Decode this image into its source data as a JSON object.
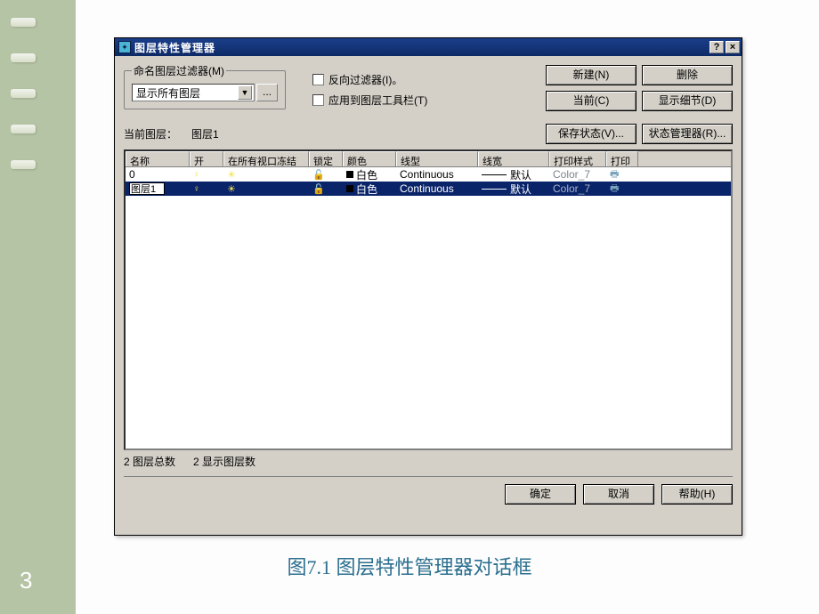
{
  "slide": {
    "page_number": "3",
    "caption": "图7.1  图层特性管理器对话框"
  },
  "dialog": {
    "title": "图层特性管理器",
    "help_btn": "?",
    "close_btn": "×",
    "filter": {
      "legend": "命名图层过滤器(M)",
      "selected": "显示所有图层",
      "more_btn": "...",
      "reverse_filter": "反向过滤器(I)。",
      "apply_toolbar": "应用到图层工具栏(T)"
    },
    "buttons": {
      "new": "新建(N)",
      "delete": "删除",
      "current": "当前(C)",
      "show_detail": "显示细节(D)",
      "save_state": "保存状态(V)...",
      "state_mgr": "状态管理器(R)...",
      "ok": "确定",
      "cancel": "取消",
      "help": "帮助(H)"
    },
    "current_layer_label": "当前图层：",
    "current_layer_value": "图层1",
    "columns": {
      "name": "名称",
      "on": "开",
      "freeze": "在所有视口冻结",
      "lock": "锁定",
      "color": "颜色",
      "linetype": "线型",
      "lineweight": "线宽",
      "plotstyle": "打印样式",
      "print": "打印"
    },
    "rows": [
      {
        "name": "0",
        "color_name": "白色",
        "swatch": "#000000",
        "linetype": "Continuous",
        "lineweight": "默认",
        "plotstyle": "Color_7",
        "selected": false
      },
      {
        "name": "图层1",
        "color_name": "白色",
        "swatch": "#000000",
        "linetype": "Continuous",
        "lineweight": "默认",
        "plotstyle": "Color_7",
        "selected": true
      }
    ],
    "status": {
      "total_prefix": "2 图层总数",
      "shown_prefix": "2 显示图层数"
    }
  }
}
